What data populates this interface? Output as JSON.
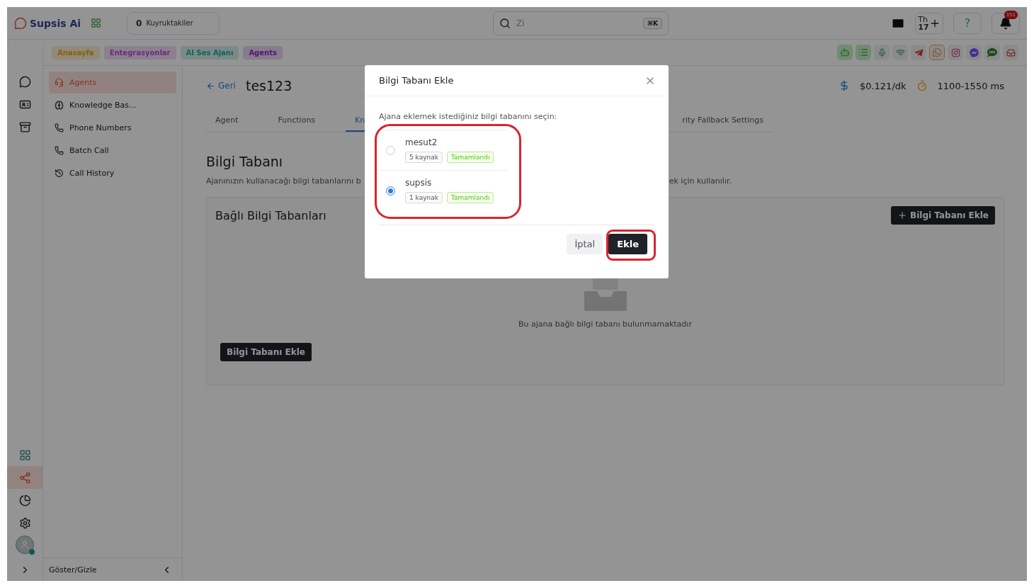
{
  "header": {
    "brand": "Supsis Ai",
    "queue": {
      "count": "0",
      "label": "Kuyruktakiler"
    },
    "search": {
      "placeholder": "Zi",
      "shortcut": "⌘K"
    },
    "calendar": {
      "abbr": "Th",
      "day": "17"
    },
    "notifications": {
      "count": "151"
    },
    "help_mark": "?"
  },
  "breadcrumbs": [
    {
      "label": "Anasayfa",
      "kind": "home"
    },
    {
      "label": "Entegrasyonlar",
      "kind": "integrations"
    },
    {
      "label": "AI Ses Ajanı",
      "kind": "voice"
    },
    {
      "label": "Agents",
      "kind": "agents"
    }
  ],
  "channels": [
    {
      "kind": "bot",
      "active": true,
      "selected": false
    },
    {
      "kind": "list",
      "active": true,
      "selected": false
    },
    {
      "kind": "voice",
      "active": false,
      "selected": false
    },
    {
      "kind": "wifi",
      "active": false,
      "selected": false
    },
    {
      "kind": "telegram",
      "active": false,
      "selected": false
    },
    {
      "kind": "whatsapp",
      "active": false,
      "selected": true
    },
    {
      "kind": "instagram",
      "active": false,
      "selected": false
    },
    {
      "kind": "messenger",
      "active": false,
      "selected": false
    },
    {
      "kind": "sms",
      "active": false,
      "selected": false
    },
    {
      "kind": "inbox",
      "active": false,
      "selected": false
    }
  ],
  "rail": {
    "top": [
      {
        "kind": "chat",
        "selected": false
      },
      {
        "kind": "contact",
        "selected": false
      },
      {
        "kind": "tray",
        "selected": false
      }
    ],
    "bottom": [
      {
        "kind": "apps",
        "selected": false
      },
      {
        "kind": "share",
        "selected": true
      },
      {
        "kind": "reports",
        "selected": false
      },
      {
        "kind": "settings",
        "selected": false
      }
    ]
  },
  "sidebar": {
    "items": [
      {
        "kind": "agent",
        "label": "Agents",
        "selected": true
      },
      {
        "kind": "brain",
        "label": "Knowledge Bas...",
        "selected": false
      },
      {
        "kind": "phone",
        "label": "Phone Numbers",
        "selected": false
      },
      {
        "kind": "phone",
        "label": "Batch Call",
        "selected": false
      },
      {
        "kind": "history",
        "label": "Call History",
        "selected": false
      }
    ],
    "footer": "Göster/Gizle"
  },
  "page": {
    "back": "Geri",
    "title": "tes123",
    "price": "$0.121/dk",
    "latency": "1100-1550 ms",
    "tabs": [
      {
        "label": "Agent",
        "selected": false
      },
      {
        "label": "Functions",
        "selected": false
      },
      {
        "label": "Kn",
        "selected": true
      },
      {
        "label": "rity Fallback Settings",
        "selected": false
      }
    ],
    "section_title": "Bilgi Tabanı",
    "description_parts": [
      "Ajanınızın kullanacağı bilgi tabanlarını b",
      "ek için kullanılır."
    ],
    "card": {
      "title": "Bağlı Bilgi Tabanları",
      "add_button": "Bilgi Tabanı Ekle",
      "empty_text": "Bu ajana bağlı bilgi tabanı bulunmamaktadır",
      "bottom_button": "Bilgi Tabanı Ekle"
    }
  },
  "modal": {
    "title": "Bilgi Tabanı Ekle",
    "prompt": "Ajana eklemek istediğiniz bilgi tabanını seçin:",
    "options": [
      {
        "name": "mesut2",
        "sources": "5 kaynak",
        "status": "Tamamlandı",
        "selected": false
      },
      {
        "name": "supsis",
        "sources": "1 kaynak",
        "status": "Tamamlandı",
        "selected": true
      }
    ],
    "cancel": "İptal",
    "confirm": "Ekle"
  }
}
